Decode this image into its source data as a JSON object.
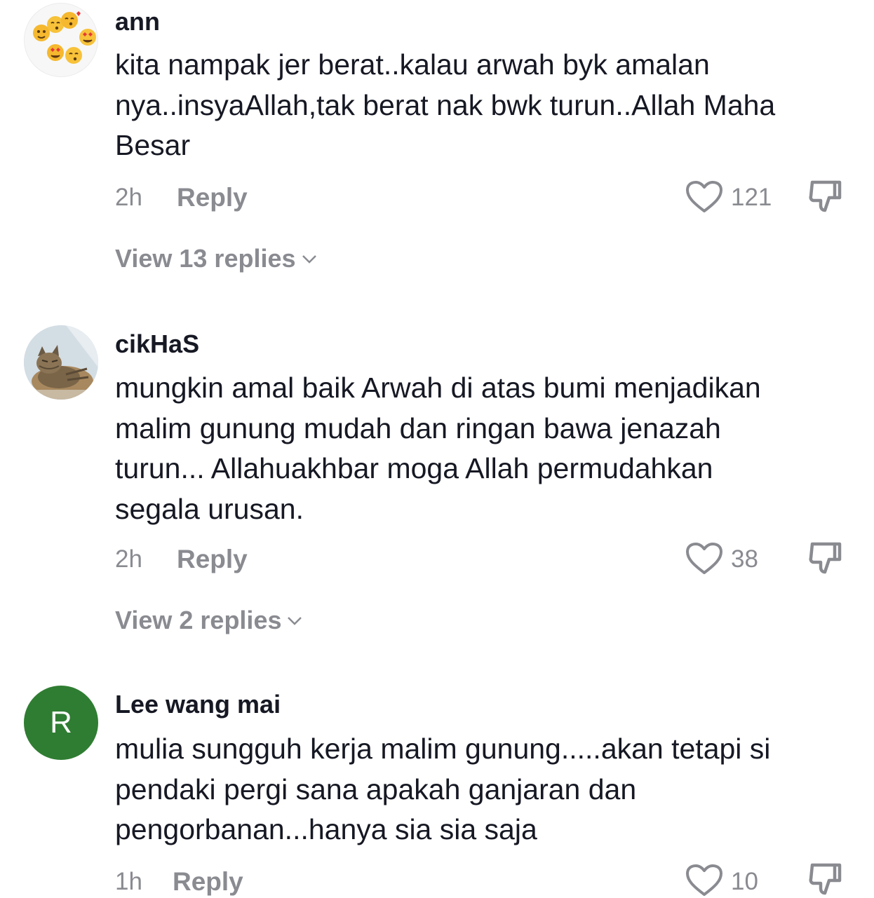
{
  "comments": [
    {
      "username": "ann",
      "avatar": "emoji-faces",
      "text": "kita nampak jer berat..kalau arwah byk amalan\nnya..insyaAllah,tak berat nak bwk turun..Allah Maha\nBesar",
      "time": "2h",
      "reply_label": "Reply",
      "likes": "121",
      "view_replies": "View 13 replies"
    },
    {
      "username": "cikHaS",
      "avatar": "cat-photo",
      "text": "mungkin amal baik Arwah di atas bumi menjadikan\nmalim gunung mudah dan ringan bawa jenazah\nturun... Allahuakhbar moga Allah permudahkan\nsegala urusan.",
      "time": "2h",
      "reply_label": "Reply",
      "likes": "38",
      "view_replies": "View 2 replies"
    },
    {
      "username": "Lee wang mai",
      "avatar_letter": "R",
      "avatar_color": "#2f7d32",
      "text": "mulia sungguh kerja malim gunung.....akan tetapi si\npendaki pergi sana apakah ganjaran dan\npengorbanan...hanya sia sia saja",
      "time": "1h",
      "reply_label": "Reply",
      "likes": "10"
    }
  ],
  "colors": {
    "text": "#161823",
    "muted": "#8a8b91",
    "avatar_green": "#2f7d32"
  },
  "icons": {
    "like": "heart-outline-icon",
    "dislike": "thumbs-down-outline-icon",
    "expand": "chevron-down-icon"
  }
}
